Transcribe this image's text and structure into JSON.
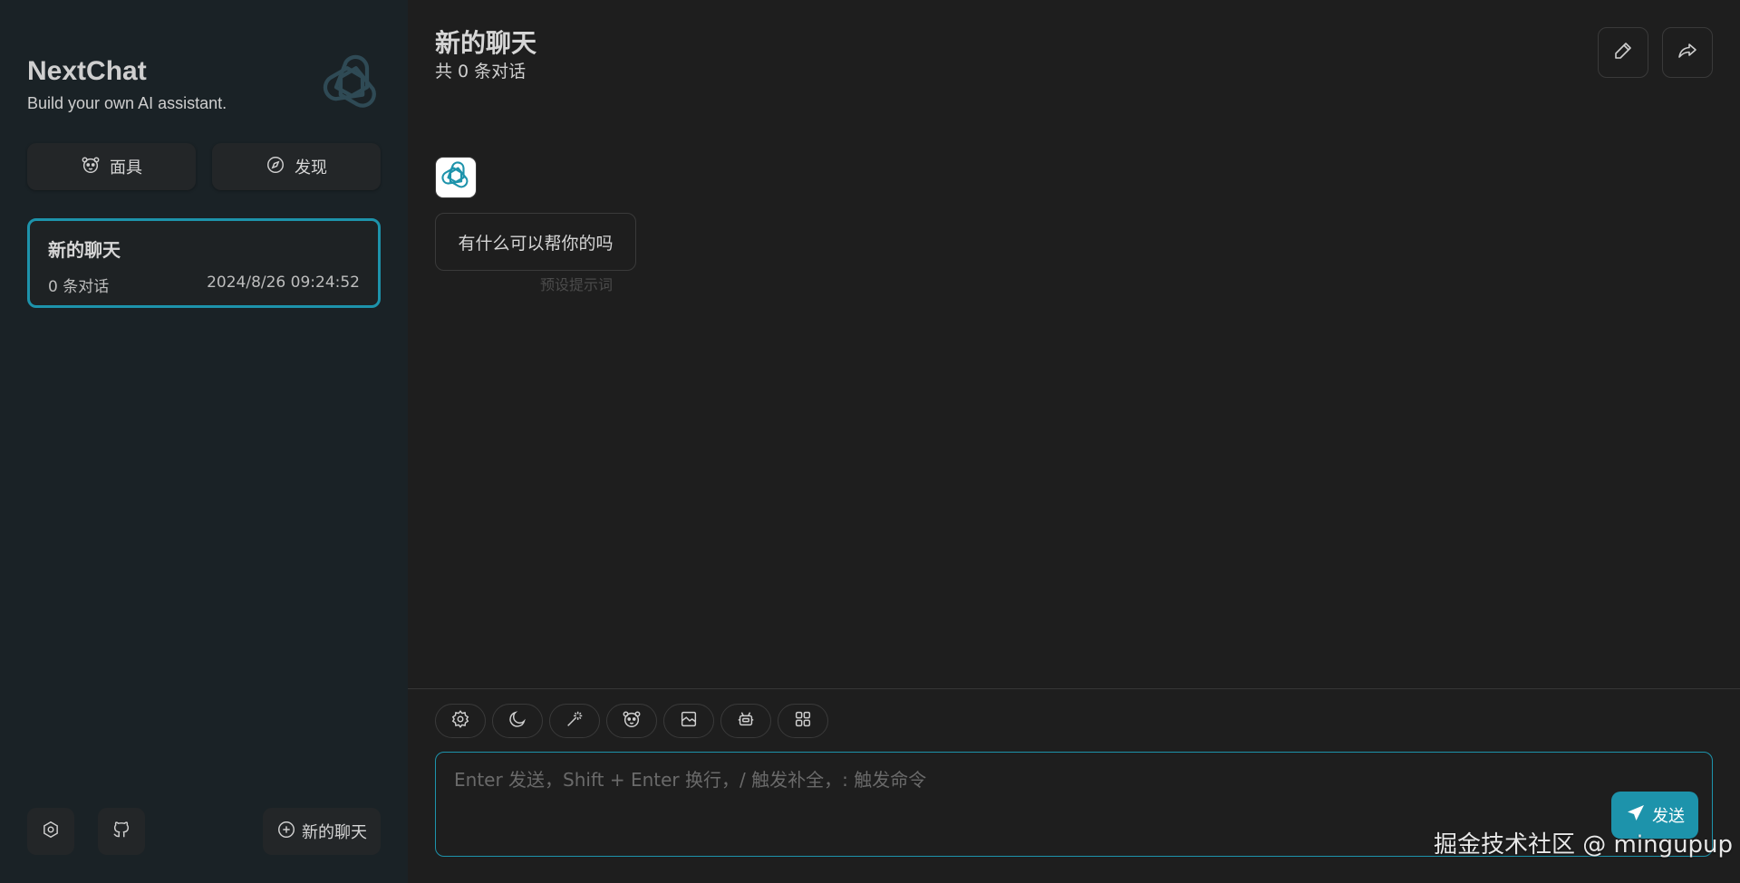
{
  "app": {
    "name": "NextChat",
    "tagline": "Build your own AI assistant."
  },
  "sidebar": {
    "mask_button": {
      "label": "面具",
      "icon": "mask-icon"
    },
    "discover_button": {
      "label": "发现",
      "icon": "compass-icon"
    },
    "chats": [
      {
        "title": "新的聊天",
        "count": "0 条对话",
        "timestamp": "2024/8/26 09:24:52",
        "selected": true
      }
    ],
    "settings_icon": "settings-icon",
    "github_icon": "github-icon",
    "new_chat_button": {
      "label": "新的聊天",
      "icon": "plus-circle-icon"
    }
  },
  "main": {
    "title": "新的聊天",
    "subtitle": "共 0 条对话",
    "header_buttons": [
      "edit-icon",
      "share-icon"
    ],
    "messages": [
      {
        "role": "assistant",
        "text": "有什么可以帮你的吗",
        "note": "预设提示词"
      }
    ],
    "toolbar": [
      "settings-icon",
      "moon-icon",
      "magic-wand-icon",
      "mask-icon",
      "image-icon",
      "robot-icon",
      "grid-icon"
    ],
    "input": {
      "placeholder": "Enter 发送，Shift + Enter 换行，/ 触发补全，: 触发命令"
    },
    "send_button": {
      "label": "发送",
      "icon": "send-icon"
    }
  },
  "watermark": "掘金技术社区 @ mingupup",
  "colors": {
    "accent": "#1d93ab",
    "sidebar_bg": "#1a2226",
    "main_bg": "#1e1e1e"
  }
}
